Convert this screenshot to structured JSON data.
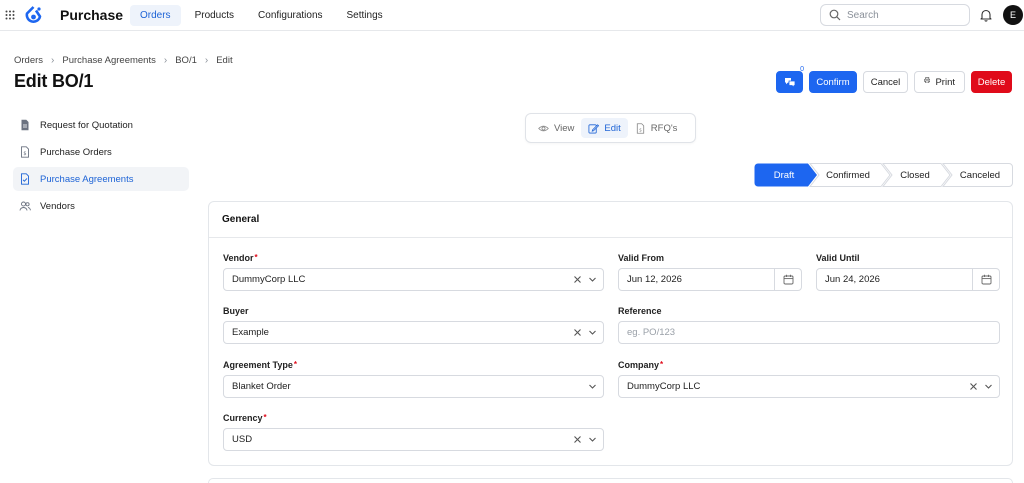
{
  "app": {
    "title": "Purchase",
    "user_initial": "E"
  },
  "nav": [
    "Orders",
    "Products",
    "Configurations",
    "Settings"
  ],
  "search": {
    "placeholder": "Search"
  },
  "breadcrumb": [
    "Orders",
    "Purchase Agreements",
    "BO/1",
    "Edit"
  ],
  "page": {
    "title": "Edit BO/1"
  },
  "actions": {
    "notification_count": "0",
    "confirm": "Confirm",
    "cancel": "Cancel",
    "print": "Print",
    "delete": "Delete"
  },
  "sidebar": {
    "items": [
      {
        "label": "Request for Quotation",
        "icon": "document-icon"
      },
      {
        "label": "Purchase Orders",
        "icon": "file-dollar-icon"
      },
      {
        "label": "Purchase Agreements",
        "icon": "file-check-icon",
        "active": true
      },
      {
        "label": "Vendors",
        "icon": "users-icon"
      }
    ]
  },
  "view_toggle": {
    "view": "View",
    "edit": "Edit",
    "rfqs": "RFQ's"
  },
  "status_steps": {
    "items": [
      "Draft",
      "Confirmed",
      "Closed",
      "Canceled"
    ],
    "active": "Draft"
  },
  "general": {
    "title": "General",
    "vendor": {
      "label": "Vendor",
      "value": "DummyCorp LLC"
    },
    "valid_from": {
      "label": "Valid From",
      "value": "Jun 12, 2026"
    },
    "valid_until": {
      "label": "Valid Until",
      "value": "Jun 24, 2026"
    },
    "buyer": {
      "label": "Buyer",
      "value": "Example"
    },
    "reference": {
      "label": "Reference",
      "placeholder": "eg. PO/123"
    },
    "agreement_type": {
      "label": "Agreement Type",
      "value": "Blanket Order"
    },
    "company": {
      "label": "Company",
      "value": "DummyCorp LLC"
    },
    "currency": {
      "label": "Currency",
      "value": "USD"
    }
  },
  "colors": {
    "accent": "#1d66f0",
    "danger": "#e00b1a",
    "required": "#e00b1a"
  }
}
